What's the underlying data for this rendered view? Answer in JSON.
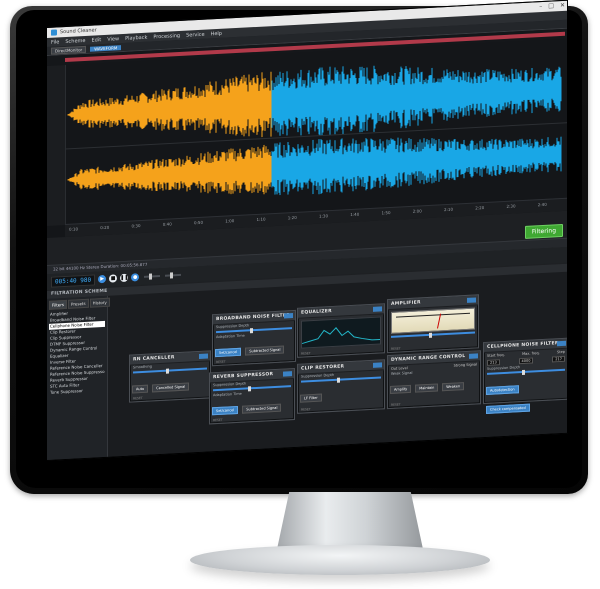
{
  "window": {
    "title": "Sound Cleaner",
    "controls": [
      "–",
      "□",
      "✕"
    ]
  },
  "menu": [
    "File",
    "Scheme",
    "Edit",
    "View",
    "Playback",
    "Processing",
    "Service",
    "Help"
  ],
  "toolbar": {
    "dropdown": "DirectMonitor",
    "tab": "WAVEFORM"
  },
  "waveform": {
    "time_labels": [
      "0:10",
      "0:20",
      "0:30",
      "0:40",
      "0:50",
      "1:00",
      "1:10",
      "1:20",
      "1:30",
      "1:40",
      "1:50",
      "2:00",
      "2:10",
      "2:20",
      "2:30",
      "2:40"
    ],
    "colors": {
      "selected": "#f5a21b",
      "unselected": "#19a7e6",
      "overview": "#b23a4a"
    }
  },
  "filtering_button": "Filtering",
  "status_line": "32 bit 44100 Hz  Stereo  Duration: 00:05:56.877",
  "transport": {
    "time": "005:40 980"
  },
  "scheme": {
    "header": "FILTRATION SCHEME",
    "tabs": [
      "Filters",
      "Presets",
      "History"
    ],
    "filters": [
      "Amplifier",
      "Broadband Noise Filter",
      "Cellphone Noise Filter",
      "Clip Restorer",
      "Clip Suppressor",
      "DTMF Suppressor",
      "Dynamic Range Control",
      "Equalizer",
      "Inverse Filter",
      "Reference Noise Canceller",
      "Reference Noise Suppressor",
      "Reverb Suppressor",
      "STC Auto Filter",
      "Tone Suppressor"
    ],
    "selected_filter": "Cellphone Noise Filter"
  },
  "modules": {
    "broadband": {
      "title": "BROADBAND NOISE FILTER",
      "suppression": "Suppression Depth",
      "adaptation": "Adaptation Time",
      "btn1": "Set/cancel",
      "btn2": "Subtracted Signal"
    },
    "equalizer": {
      "title": "EQUALIZER"
    },
    "amplifier": {
      "title": "AMPLIFIER"
    },
    "canceller": {
      "title": "RN CANCELLER",
      "label": "Smoothing",
      "btn1": "Auto",
      "btn2": "Cancelled Signal"
    },
    "reverb": {
      "title": "REVERB SUPPRESSOR",
      "suppression": "Suppression Depth",
      "adaptation": "Adaptation Time",
      "btn1": "Set/cancel",
      "btn2": "Subtracted Signal"
    },
    "clip": {
      "title": "CLIP RESTORER",
      "label": "Suppression Depth",
      "btn1": "LF Filter"
    },
    "drc": {
      "title": "DYNAMIC RANGE CONTROL",
      "out_level": "Out Level",
      "strong": "Strong Signal",
      "weak": "Weak Signal",
      "opt1": "Amplify",
      "opt2": "Maintain",
      "opt3": "Weaken"
    },
    "cellphone": {
      "title": "CELLPHONE NOISE FILTER",
      "start": "Start freq.",
      "max": "Max. freq.",
      "step": "Step",
      "start_v": "213",
      "max_v": "4000",
      "step_v": "217",
      "depth": "Suppression Depth",
      "btn1": "Autodetection",
      "btn2": "Check compensated"
    }
  },
  "reset_label": "RESET"
}
